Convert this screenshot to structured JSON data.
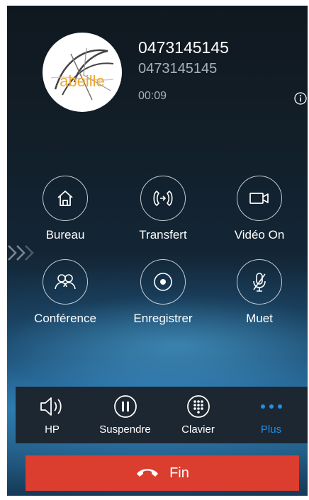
{
  "caller": {
    "number": "0473145145",
    "subtitle": "0473145145",
    "duration": "00:09",
    "avatar_text": "abeille"
  },
  "actions": [
    {
      "label": "Bureau",
      "icon": "home-icon"
    },
    {
      "label": "Transfert",
      "icon": "transfer-icon"
    },
    {
      "label": "Vidéo On",
      "icon": "video-camera-icon"
    },
    {
      "label": "Conférence",
      "icon": "conference-icon"
    },
    {
      "label": "Enregistrer",
      "icon": "record-icon"
    },
    {
      "label": "Muet",
      "icon": "mute-microphone-icon"
    }
  ],
  "bottom_bar": [
    {
      "label": "HP",
      "icon": "speaker-icon"
    },
    {
      "label": "Suspendre",
      "icon": "pause-icon"
    },
    {
      "label": "Clavier",
      "icon": "keypad-icon"
    },
    {
      "label": "Plus",
      "icon": "more-dots-icon",
      "active": true
    }
  ],
  "end_call": {
    "label": "Fin",
    "icon": "hang-up-icon"
  },
  "colors": {
    "accent": "#1e90e8",
    "end_call": "#db3d2e",
    "avatar_text": "#f0a830"
  }
}
